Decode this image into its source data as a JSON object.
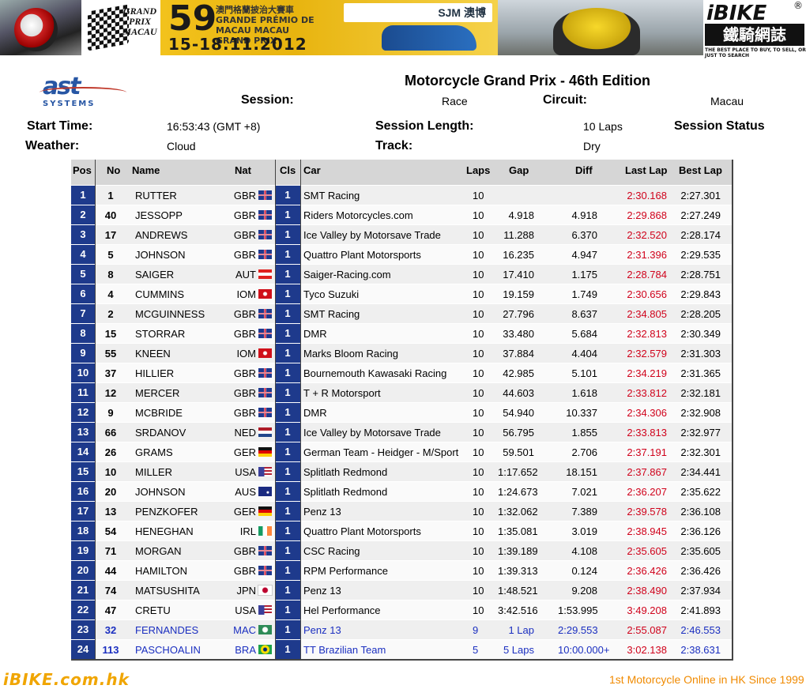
{
  "banner": {
    "gp_text": "GRAND PRIX MACAU",
    "edition_num": "59",
    "edition_sub": "澳門格蘭披治大賽車 GRANDE PRÉMIO DE MACAU MACAU GRAND PRIX",
    "dates": "15-18.11.2012",
    "sponsor": "SJM 澳博",
    "ibike_logo": "iBIKE",
    "ibike_cn": "鐵騎網誌",
    "ibike_tag": "THE BEST PLACE TO BUY, TO SELL, OR JUST TO SEARCH"
  },
  "header": {
    "logo_text": "ast",
    "logo_sub": "SYSTEMS",
    "title": "Motorcycle Grand Prix - 46th Edition",
    "session_label": "Session:",
    "session_value": "Race",
    "circuit_label": "Circuit:",
    "circuit_value": "Macau",
    "start_label": "Start Time:",
    "start_value": "16:53:43  (GMT +8)",
    "length_label": "Session Length:",
    "length_value": "10 Laps",
    "status_label": "Session Status",
    "weather_label": "Weather:",
    "weather_value": "Cloud",
    "track_label": "Track:",
    "track_value": "Dry"
  },
  "columns": {
    "pos": "Pos",
    "no": "No",
    "name": "Name",
    "nat": "Nat",
    "cls": "Cls",
    "car": "Car",
    "laps": "Laps",
    "gap": "Gap",
    "diff": "Diff",
    "last": "Last Lap",
    "best": "Best Lap"
  },
  "flag_colors": {
    "GBR": "#1f3a8f",
    "AUT": "#e0201d",
    "IOM": "#d0101a",
    "NED": "#2050b0",
    "GER": "#111111",
    "USA": "#3a3f9a",
    "AUS": "#1a2a80",
    "IRL": "#169b62",
    "JPN": "#ffffff",
    "MAC": "#2e8b57",
    "BRA": "#1ea34a"
  },
  "rows": [
    {
      "pos": "1",
      "no": "1",
      "name": "RUTTER",
      "nat": "GBR",
      "cls": "1",
      "car": "SMT Racing",
      "laps": "10",
      "gap": "",
      "diff": "",
      "last": "2:30.168",
      "best": "2:27.301"
    },
    {
      "pos": "2",
      "no": "40",
      "name": "JESSOPP",
      "nat": "GBR",
      "cls": "1",
      "car": "Riders Motorcycles.com",
      "laps": "10",
      "gap": "4.918",
      "diff": "4.918",
      "last": "2:29.868",
      "best": "2:27.249"
    },
    {
      "pos": "3",
      "no": "17",
      "name": "ANDREWS",
      "nat": "GBR",
      "cls": "1",
      "car": "Ice Valley by Motorsave Trade",
      "laps": "10",
      "gap": "11.288",
      "diff": "6.370",
      "last": "2:32.520",
      "best": "2:28.174"
    },
    {
      "pos": "4",
      "no": "5",
      "name": "JOHNSON",
      "nat": "GBR",
      "cls": "1",
      "car": "Quattro Plant Motorsports",
      "laps": "10",
      "gap": "16.235",
      "diff": "4.947",
      "last": "2:31.396",
      "best": "2:29.535"
    },
    {
      "pos": "5",
      "no": "8",
      "name": "SAIGER",
      "nat": "AUT",
      "cls": "1",
      "car": "Saiger-Racing.com",
      "laps": "10",
      "gap": "17.410",
      "diff": "1.175",
      "last": "2:28.784",
      "best": "2:28.751"
    },
    {
      "pos": "6",
      "no": "4",
      "name": "CUMMINS",
      "nat": "IOM",
      "cls": "1",
      "car": "Tyco Suzuki",
      "laps": "10",
      "gap": "19.159",
      "diff": "1.749",
      "last": "2:30.656",
      "best": "2:29.843"
    },
    {
      "pos": "7",
      "no": "2",
      "name": "MCGUINNESS",
      "nat": "GBR",
      "cls": "1",
      "car": "SMT Racing",
      "laps": "10",
      "gap": "27.796",
      "diff": "8.637",
      "last": "2:34.805",
      "best": "2:28.205"
    },
    {
      "pos": "8",
      "no": "15",
      "name": "STORRAR",
      "nat": "GBR",
      "cls": "1",
      "car": "DMR",
      "laps": "10",
      "gap": "33.480",
      "diff": "5.684",
      "last": "2:32.813",
      "best": "2:30.349"
    },
    {
      "pos": "9",
      "no": "55",
      "name": "KNEEN",
      "nat": "IOM",
      "cls": "1",
      "car": "Marks Bloom Racing",
      "laps": "10",
      "gap": "37.884",
      "diff": "4.404",
      "last": "2:32.579",
      "best": "2:31.303"
    },
    {
      "pos": "10",
      "no": "37",
      "name": "HILLIER",
      "nat": "GBR",
      "cls": "1",
      "car": "Bournemouth Kawasaki Racing",
      "laps": "10",
      "gap": "42.985",
      "diff": "5.101",
      "last": "2:34.219",
      "best": "2:31.365"
    },
    {
      "pos": "11",
      "no": "12",
      "name": "MERCER",
      "nat": "GBR",
      "cls": "1",
      "car": "T + R Motorsport",
      "laps": "10",
      "gap": "44.603",
      "diff": "1.618",
      "last": "2:33.812",
      "best": "2:32.181"
    },
    {
      "pos": "12",
      "no": "9",
      "name": "MCBRIDE",
      "nat": "GBR",
      "cls": "1",
      "car": "DMR",
      "laps": "10",
      "gap": "54.940",
      "diff": "10.337",
      "last": "2:34.306",
      "best": "2:32.908"
    },
    {
      "pos": "13",
      "no": "66",
      "name": "SRDANOV",
      "nat": "NED",
      "cls": "1",
      "car": "Ice Valley by Motorsave Trade",
      "laps": "10",
      "gap": "56.795",
      "diff": "1.855",
      "last": "2:33.813",
      "best": "2:32.977"
    },
    {
      "pos": "14",
      "no": "26",
      "name": "GRAMS",
      "nat": "GER",
      "cls": "1",
      "car": "German Team - Heidger - M/Sport",
      "laps": "10",
      "gap": "59.501",
      "diff": "2.706",
      "last": "2:37.191",
      "best": "2:32.301"
    },
    {
      "pos": "15",
      "no": "10",
      "name": "MILLER",
      "nat": "USA",
      "cls": "1",
      "car": "Splitlath Redmond",
      "laps": "10",
      "gap": "1:17.652",
      "diff": "18.151",
      "last": "2:37.867",
      "best": "2:34.441"
    },
    {
      "pos": "16",
      "no": "20",
      "name": "JOHNSON",
      "nat": "AUS",
      "cls": "1",
      "car": "Splitlath Redmond",
      "laps": "10",
      "gap": "1:24.673",
      "diff": "7.021",
      "last": "2:36.207",
      "best": "2:35.622"
    },
    {
      "pos": "17",
      "no": "13",
      "name": "PENZKOFER",
      "nat": "GER",
      "cls": "1",
      "car": "Penz 13",
      "laps": "10",
      "gap": "1:32.062",
      "diff": "7.389",
      "last": "2:39.578",
      "best": "2:36.108"
    },
    {
      "pos": "18",
      "no": "54",
      "name": "HENEGHAN",
      "nat": "IRL",
      "cls": "1",
      "car": "Quattro Plant Motorsports",
      "laps": "10",
      "gap": "1:35.081",
      "diff": "3.019",
      "last": "2:38.945",
      "best": "2:36.126"
    },
    {
      "pos": "19",
      "no": "71",
      "name": "MORGAN",
      "nat": "GBR",
      "cls": "1",
      "car": "CSC Racing",
      "laps": "10",
      "gap": "1:39.189",
      "diff": "4.108",
      "last": "2:35.605",
      "best": "2:35.605"
    },
    {
      "pos": "20",
      "no": "44",
      "name": "HAMILTON",
      "nat": "GBR",
      "cls": "1",
      "car": "RPM Performance",
      "laps": "10",
      "gap": "1:39.313",
      "diff": "0.124",
      "last": "2:36.426",
      "best": "2:36.426"
    },
    {
      "pos": "21",
      "no": "74",
      "name": "MATSUSHITA",
      "nat": "JPN",
      "cls": "1",
      "car": "Penz 13",
      "laps": "10",
      "gap": "1:48.521",
      "diff": "9.208",
      "last": "2:38.490",
      "best": "2:37.934"
    },
    {
      "pos": "22",
      "no": "47",
      "name": "CRETU",
      "nat": "USA",
      "cls": "1",
      "car": "Hel Performance",
      "laps": "10",
      "gap": "3:42.516",
      "diff": "1:53.995",
      "last": "3:49.208",
      "best": "2:41.893"
    },
    {
      "pos": "23",
      "no": "32",
      "name": "FERNANDES",
      "nat": "MAC",
      "cls": "1",
      "car": "Penz 13",
      "laps": "9",
      "gap": "1 Lap",
      "diff": "2:29.553",
      "last": "2:55.087",
      "best": "2:46.553",
      "lapped": true
    },
    {
      "pos": "24",
      "no": "113",
      "name": "PASCHOALIN",
      "nat": "BRA",
      "cls": "1",
      "car": "TT Brazilian Team",
      "laps": "5",
      "gap": "5 Laps",
      "diff": "10:00.000+",
      "last": "3:02.138",
      "best": "2:38.631",
      "lapped": true
    }
  ],
  "footer": {
    "left": "iBIKE.com.hk",
    "right": "1st  Motorcycle Online in HK Since 1999"
  }
}
